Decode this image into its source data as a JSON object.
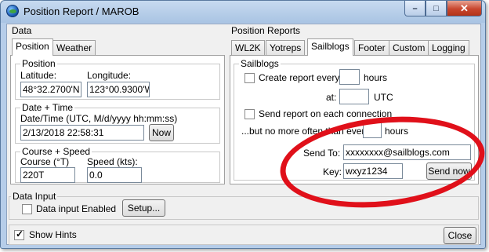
{
  "window": {
    "title": "Position Report / MAROB"
  },
  "titlebar": {
    "minimize": "–",
    "maximize": "□",
    "close": "✕"
  },
  "data": {
    "label": "Data",
    "tabs": [
      "Position",
      "Weather"
    ],
    "position": {
      "label": "Position",
      "latitude_label": "Latitude:",
      "latitude": "48°32.2700'N",
      "longitude_label": "Longitude:",
      "longitude": "123°00.9300'W"
    },
    "datetime": {
      "label": "Date + Time",
      "field_label": "Date/Time (UTC, M/d/yyyy hh:mm:ss)",
      "value": "2/13/2018 22:58:31",
      "now_button": "Now"
    },
    "course": {
      "label": "Course + Speed",
      "course_label": "Course (°T)",
      "course": "220T",
      "speed_label": "Speed (kts):",
      "speed": "0.0"
    }
  },
  "position_reports": {
    "label": "Position Reports",
    "tabs": [
      "WL2K",
      "Yotreps",
      "Sailblogs",
      "Footer",
      "Custom",
      "Logging"
    ],
    "active_tab": "Sailblogs",
    "sailblogs": {
      "label": "Sailblogs",
      "create_every": "Create report every",
      "hours": "hours",
      "at": "at:",
      "utc": "UTC",
      "send_on_connect": "Send report on each connection",
      "no_more_often": "...but no more often than every",
      "hours2": "hours",
      "send_to_label": "Send To:",
      "send_to": "xxxxxxxx@sailblogs.com",
      "key_label": "Key:",
      "key": "wxyz1234",
      "send_now": "Send now"
    }
  },
  "data_input": {
    "label": "Data Input",
    "enabled": "Data input Enabled",
    "setup": "Setup..."
  },
  "footer": {
    "show_hints": "Show Hints",
    "close": "Close"
  }
}
